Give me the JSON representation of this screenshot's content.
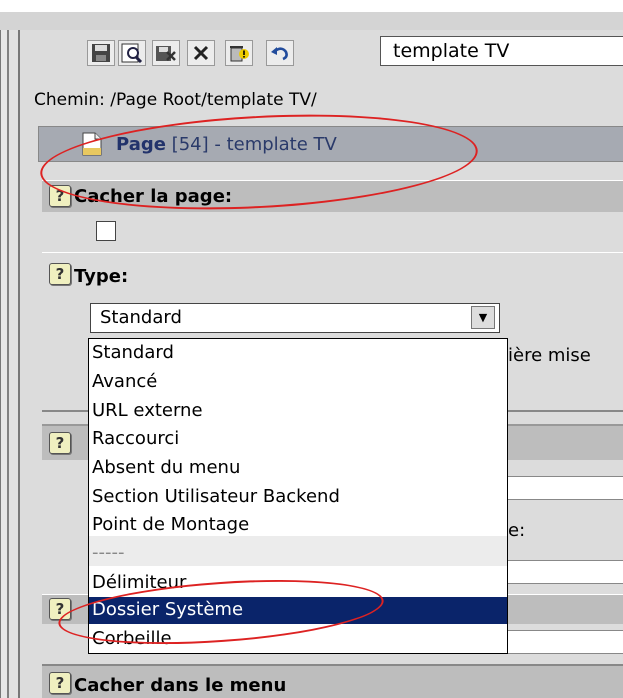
{
  "toolbar": {
    "buttons": [
      {
        "icon": "save-icon"
      },
      {
        "icon": "preview-icon"
      },
      {
        "icon": "save-close-icon"
      },
      {
        "icon": "close-icon"
      },
      {
        "icon": "delete-icon"
      },
      {
        "icon": "undo-icon"
      }
    ],
    "title_value": "template TV"
  },
  "path": "Chemin: /Page Root/template TV/",
  "page_header": {
    "label_bold": "Page",
    "label_rest": " [54] - template TV"
  },
  "fields": {
    "hide_page": "Cacher la page:",
    "type": "Type:",
    "hide_menu": "Cacher dans le menu"
  },
  "type_select": {
    "value": "Standard",
    "options": [
      "Standard",
      "Avancé",
      "URL externe",
      "Raccourci",
      "Absent du menu",
      "Section Utilisateur Backend",
      "Point de Montage",
      "-----",
      "Délimiteur",
      "Dossier Système",
      "Corbeille"
    ],
    "highlighted": "Dossier Système"
  },
  "behind_text": {
    "last_update": "ière mise",
    "colon": "e:"
  },
  "colors": {
    "highlight": "#0a246a",
    "annotation": "#dd2222"
  }
}
